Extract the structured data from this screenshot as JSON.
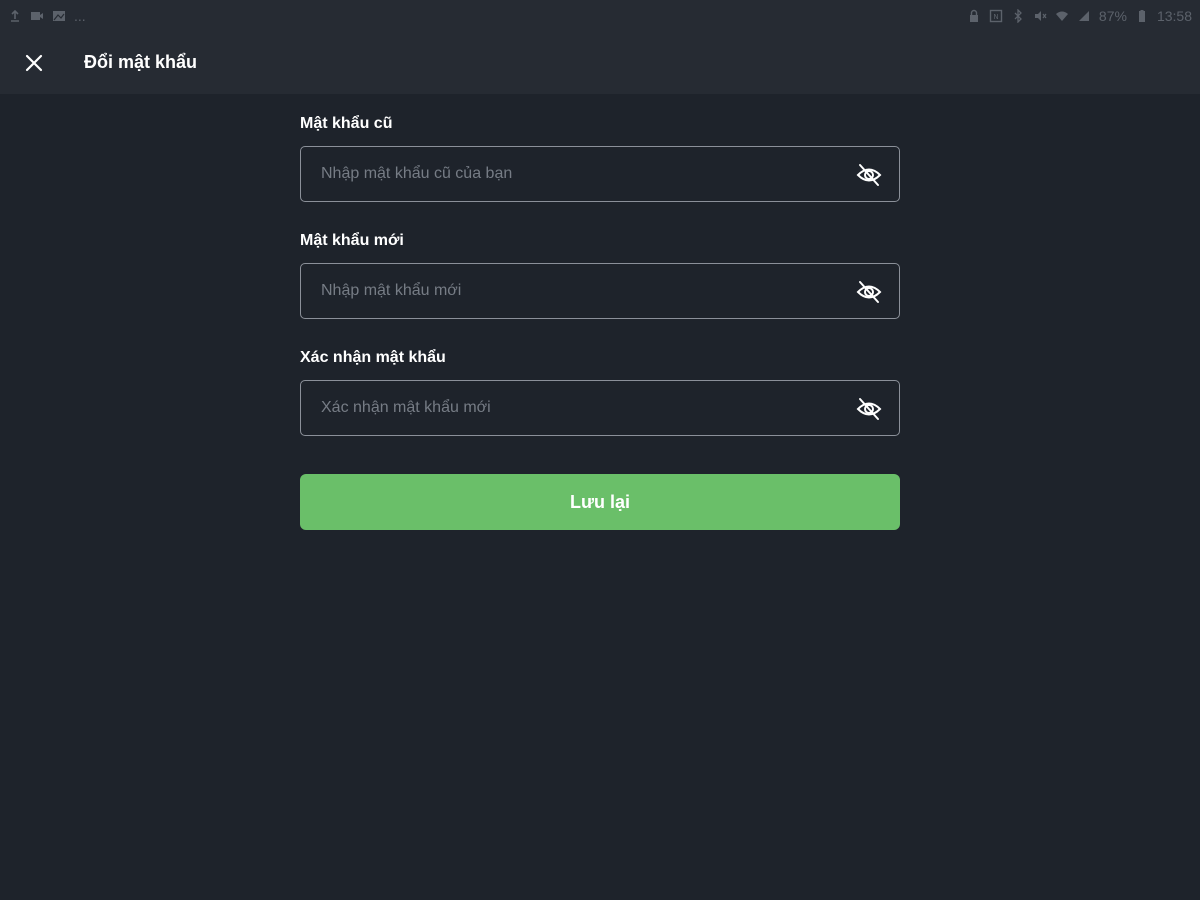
{
  "status_bar": {
    "left_dots": "...",
    "battery": "87%",
    "time": "13:58"
  },
  "header": {
    "title": "Đổi mật khẩu",
    "close_icon": "close-icon"
  },
  "form": {
    "old_password": {
      "label": "Mật khẩu cũ",
      "placeholder": "Nhập mật khẩu cũ của bạn",
      "value": "",
      "toggle_icon": "eye-off-icon"
    },
    "new_password": {
      "label": "Mật khẩu mới",
      "placeholder": "Nhập mật khẩu mới",
      "value": "",
      "toggle_icon": "eye-off-icon"
    },
    "confirm_password": {
      "label": "Xác nhận mật khẩu",
      "placeholder": "Xác nhận mật khẩu mới",
      "value": "",
      "toggle_icon": "eye-off-icon"
    },
    "save_label": "Lưu lại"
  },
  "colors": {
    "background": "#1e232b",
    "appbar": "#262b33",
    "accent": "#6abf69",
    "input_border": "#8b9099",
    "placeholder": "#767c85"
  }
}
